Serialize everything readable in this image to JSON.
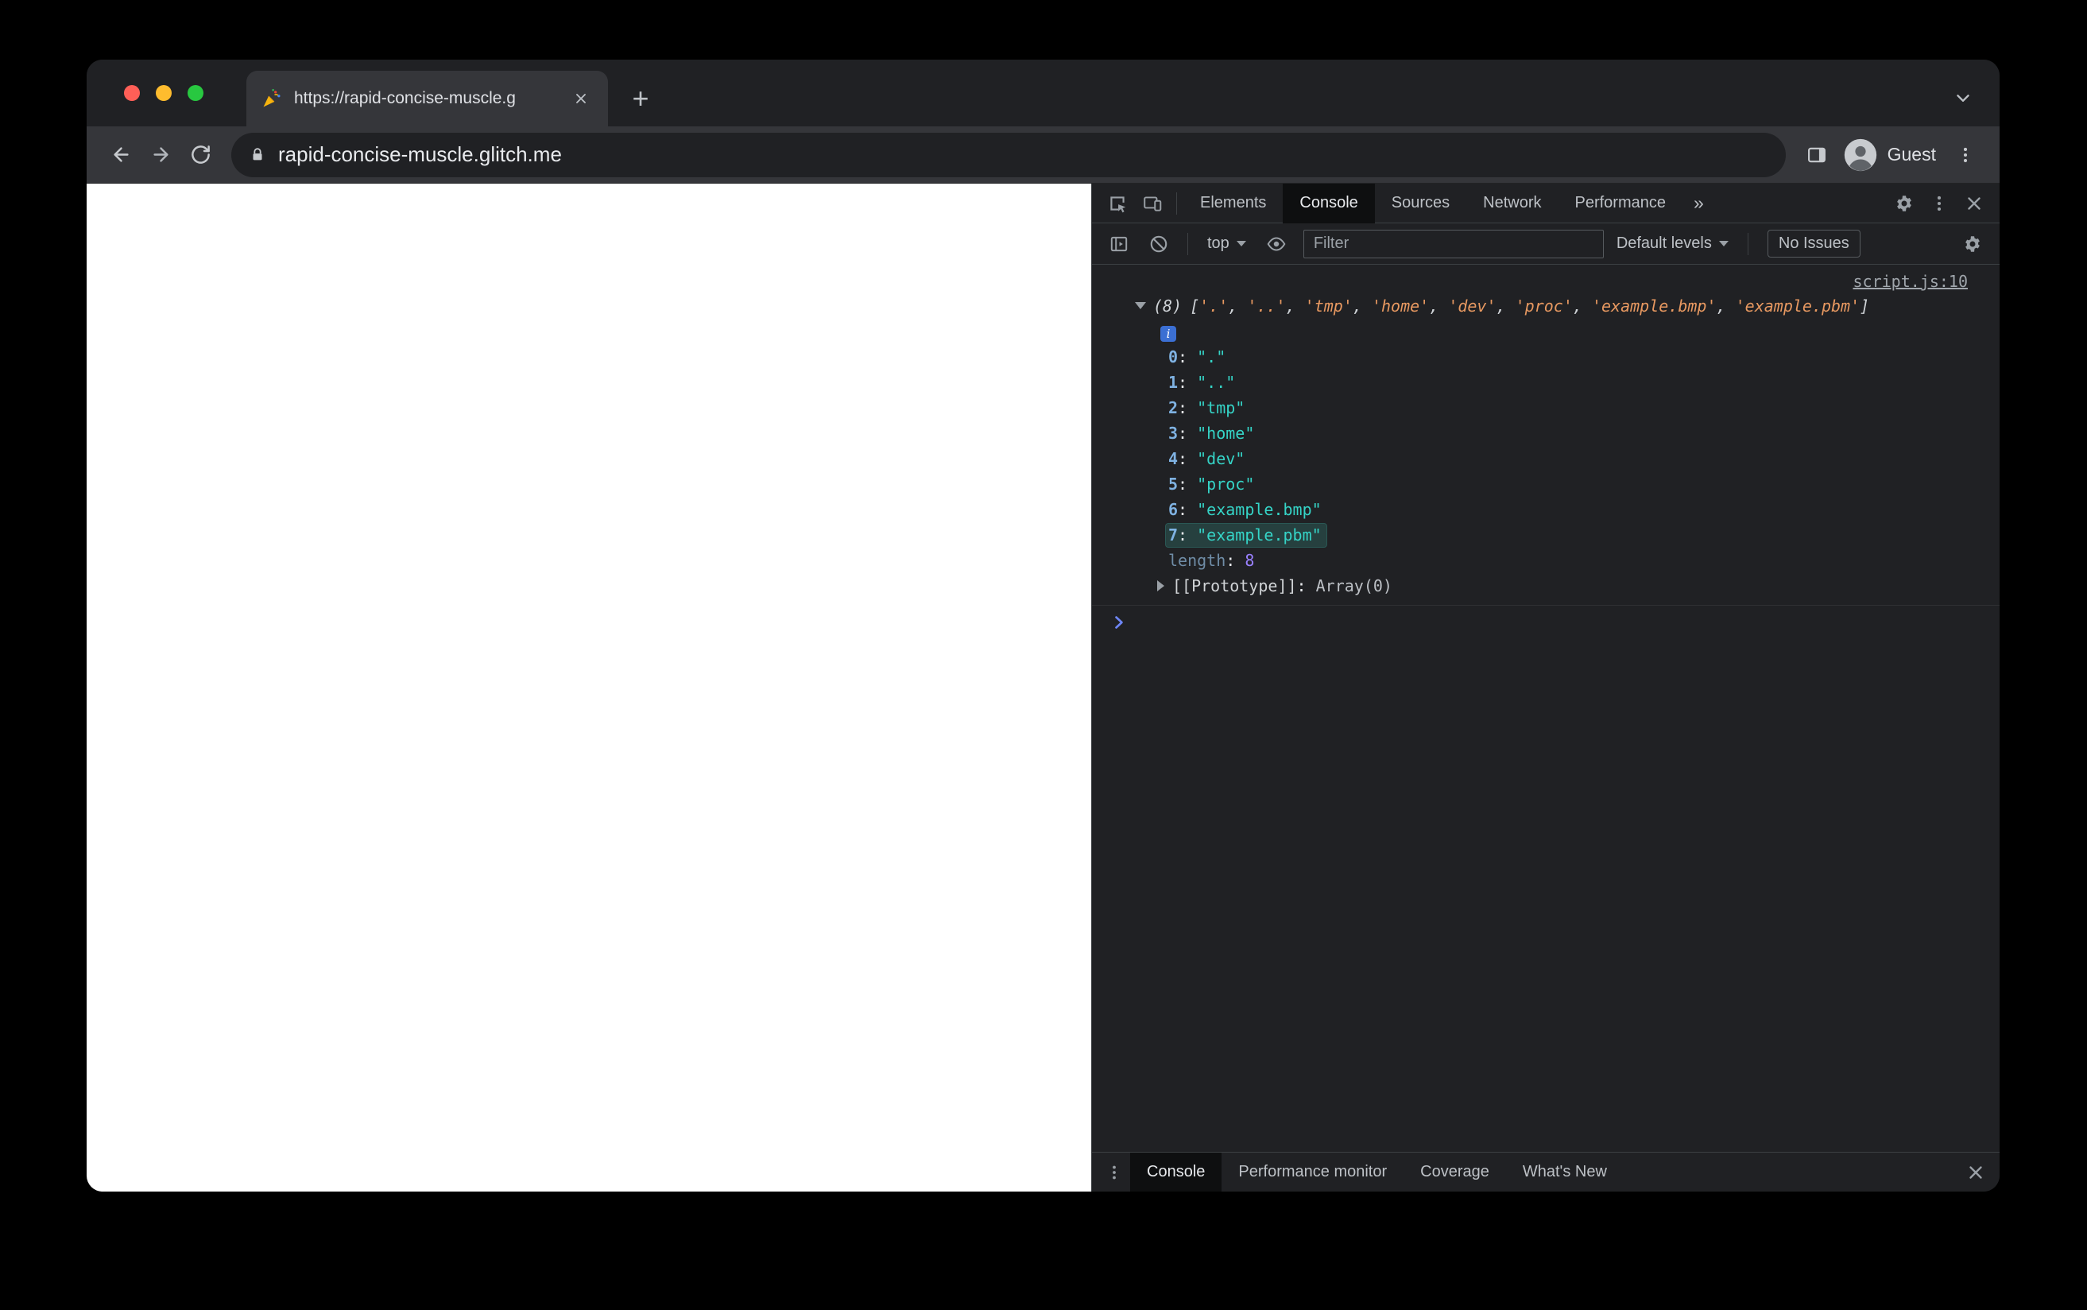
{
  "browser": {
    "tab": {
      "title": "https://rapid-concise-muscle.g",
      "favicon": "party-popper"
    },
    "url": "rapid-concise-muscle.glitch.me",
    "profile_label": "Guest"
  },
  "icons": {
    "new_tab": "+",
    "tabs_overflow": "»",
    "info_badge": "i"
  },
  "colors": {
    "traffic_red": "#ff5f57",
    "traffic_yellow": "#febc2e",
    "traffic_green": "#28c840",
    "console_preview_string": "#e89961",
    "console_value_string": "#35d4c7",
    "console_key": "#7fb2e2",
    "console_number": "#9980ff",
    "highlight": "rgba(64,188,176,0.20)"
  },
  "devtools": {
    "main_tabs": [
      "Elements",
      "Console",
      "Sources",
      "Network",
      "Performance"
    ],
    "selected_main_tab": "Console",
    "console_toolbar": {
      "context": "top",
      "filter_placeholder": "Filter",
      "levels": "Default levels",
      "issues": "No Issues"
    },
    "console": {
      "source_link": "script.js:10",
      "preview": {
        "count": "(8)",
        "open": "[",
        "close": "]",
        "sep": ", ",
        "items": [
          "'.'",
          "'..'",
          "'tmp'",
          "'home'",
          "'dev'",
          "'proc'",
          "'example.bmp'",
          "'example.pbm'"
        ]
      },
      "colon": ": ",
      "entries": [
        {
          "k": "0",
          "v": "\".\""
        },
        {
          "k": "1",
          "v": "\"..\""
        },
        {
          "k": "2",
          "v": "\"tmp\""
        },
        {
          "k": "3",
          "v": "\"home\""
        },
        {
          "k": "4",
          "v": "\"dev\""
        },
        {
          "k": "5",
          "v": "\"proc\""
        },
        {
          "k": "6",
          "v": "\"example.bmp\""
        },
        {
          "k": "7",
          "v": "\"example.pbm\"",
          "highlighted": true
        }
      ],
      "length_key": "length",
      "length_value": "8",
      "prototype_key": "[[Prototype]]",
      "prototype_value": "Array(0)"
    },
    "drawer_tabs": [
      "Console",
      "Performance monitor",
      "Coverage",
      "What's New"
    ],
    "selected_drawer_tab": "Console"
  }
}
